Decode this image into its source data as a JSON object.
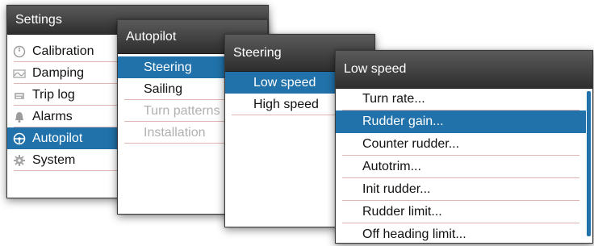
{
  "settings": {
    "title": "Settings",
    "items": [
      {
        "label": "Calibration",
        "icon": "calibration-icon"
      },
      {
        "label": "Damping",
        "icon": "damping-icon"
      },
      {
        "label": "Trip log",
        "icon": "trip-log-icon"
      },
      {
        "label": "Alarms",
        "icon": "alarm-bell-icon"
      },
      {
        "label": "Autopilot",
        "icon": "steering-wheel-icon",
        "selected": true
      },
      {
        "label": "System",
        "icon": "gear-icon"
      }
    ]
  },
  "autopilot": {
    "title": "Autopilot",
    "items": [
      {
        "label": "Steering",
        "selected": true
      },
      {
        "label": "Sailing"
      },
      {
        "label": "Turn patterns",
        "disabled": true
      },
      {
        "label": "Installation",
        "disabled": true
      }
    ]
  },
  "steering": {
    "title": "Steering",
    "items": [
      {
        "label": "Low speed",
        "selected": true
      },
      {
        "label": "High speed"
      }
    ]
  },
  "low_speed": {
    "title": "Low speed",
    "items": [
      {
        "label": "Turn rate..."
      },
      {
        "label": "Rudder gain...",
        "selected": true
      },
      {
        "label": "Counter rudder..."
      },
      {
        "label": "Autotrim..."
      },
      {
        "label": "Init rudder..."
      },
      {
        "label": "Rudder limit..."
      },
      {
        "label": "Off heading limit..."
      }
    ]
  },
  "colors": {
    "selection": "#2172aa",
    "titlebar": "#3a3a3a",
    "separator": "#e2b5b5",
    "disabled_text": "#b0b0b0"
  }
}
